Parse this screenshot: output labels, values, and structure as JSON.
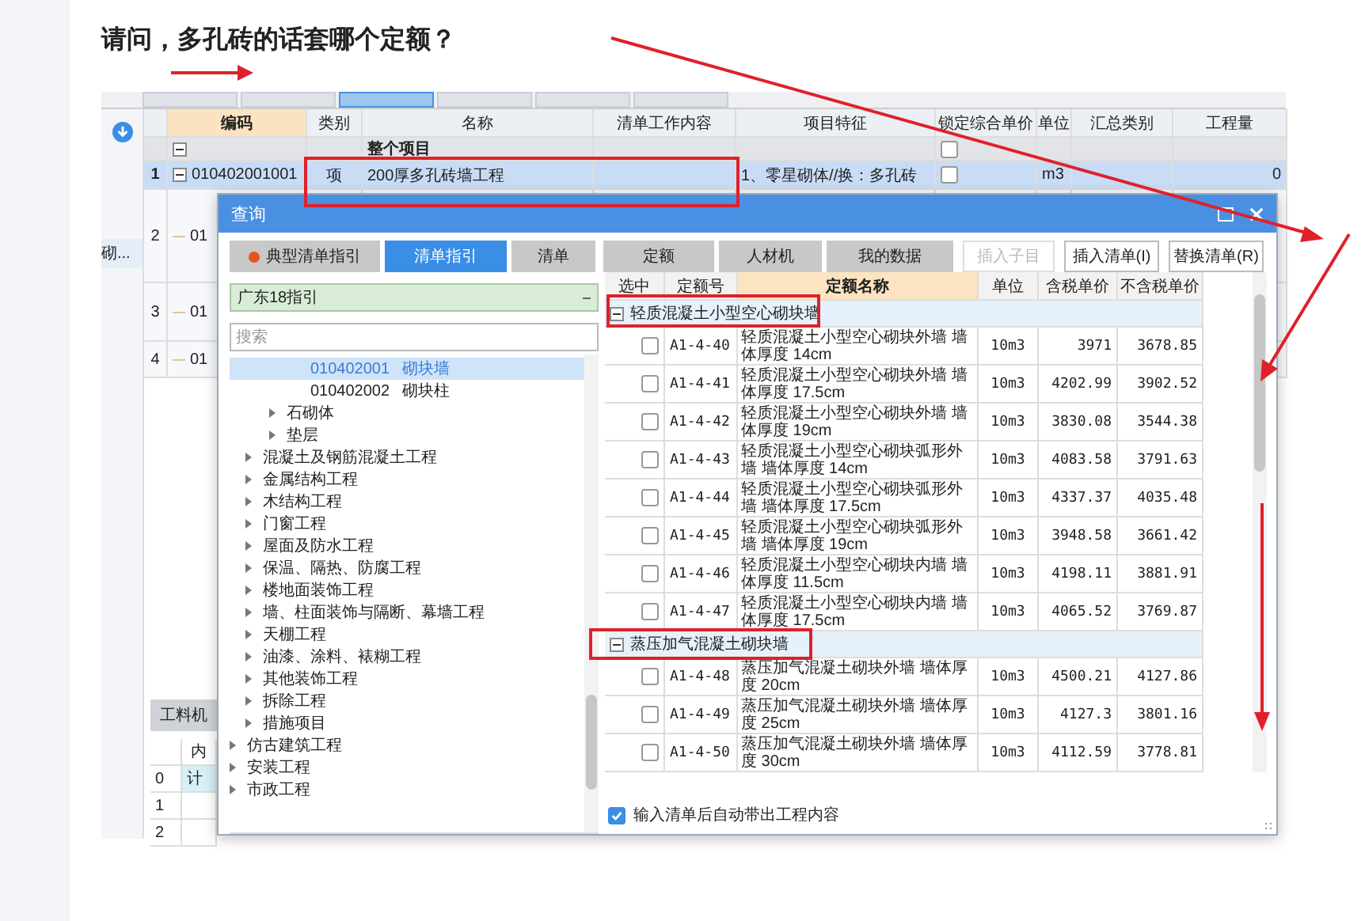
{
  "question": "请问，多孔砖的话套哪个定额？",
  "app": {
    "tabs": [
      {
        "selected": false
      },
      {
        "selected": false
      },
      {
        "selected": true
      },
      {
        "selected": false
      },
      {
        "selected": false
      },
      {
        "selected": false
      }
    ],
    "columns": [
      "编码",
      "类别",
      "名称",
      "清单工作内容",
      "项目特征",
      "锁定综合单价",
      "单位",
      "汇总类别",
      "工程量"
    ],
    "rows": [
      {
        "kind": "group",
        "name": "整个项目",
        "expanded": true,
        "locked": false,
        "selected": false
      },
      {
        "kind": "item",
        "number": "1",
        "code": "010402001001",
        "type": "项",
        "name": "200厚多孔砖墙工程",
        "feature": "1、零星砌体//换：多孔砖",
        "locked": false,
        "unit": "m3",
        "quantity": "0",
        "expanded": true,
        "selected": true
      },
      {
        "kind": "stub",
        "number": "2",
        "code": "01",
        "selected": false
      },
      {
        "kind": "stub",
        "number": "3",
        "code": "01",
        "selected": false
      },
      {
        "kind": "stub",
        "number": "4",
        "code": "01",
        "selected": false
      }
    ],
    "side_item": "砌...",
    "bottom": {
      "tab": "工料机",
      "column": "内",
      "rows": [
        {
          "number": "0",
          "content": "计"
        },
        {
          "number": "1"
        },
        {
          "number": "2"
        }
      ]
    }
  },
  "dialog": {
    "title": "查询",
    "tabs": [
      {
        "label": "典型清单指引",
        "selected": false,
        "marked": true
      },
      {
        "label": "清单指引",
        "selected": true,
        "marked": false
      },
      {
        "label": "清单",
        "selected": false,
        "marked": false
      },
      {
        "label": "定额",
        "selected": false,
        "marked": false
      },
      {
        "label": "人材机",
        "selected": false,
        "marked": false
      },
      {
        "label": "我的数据",
        "selected": false,
        "marked": false
      }
    ],
    "buttons": [
      {
        "label": "插入子目",
        "disabled": true
      },
      {
        "label": "插入清单(I)",
        "disabled": false
      },
      {
        "label": "替换清单(R)",
        "disabled": false
      }
    ],
    "guide": {
      "value": "广东18指引"
    },
    "search": {
      "placeholder": "搜索"
    },
    "tree": [
      {
        "children": [
          {
            "children": [
              {
                "children": [
                  {
                    "code": "010402001",
                    "label": "砌块墙",
                    "selected": true
                  },
                  {
                    "code": "010402002",
                    "label": "砌块柱",
                    "selected": false
                  }
                ]
              },
              {
                "label": "石砌体",
                "expanded": false,
                "selected": false
              },
              {
                "label": "垫层",
                "expanded": false,
                "selected": false
              }
            ]
          },
          {
            "label": "混凝土及钢筋混凝土工程",
            "expanded": false,
            "selected": false
          },
          {
            "label": "金属结构工程",
            "expanded": false,
            "selected": false
          },
          {
            "label": "木结构工程",
            "expanded": false,
            "selected": false
          },
          {
            "label": "门窗工程",
            "expanded": false,
            "selected": false
          },
          {
            "label": "屋面及防水工程",
            "expanded": false,
            "selected": false
          },
          {
            "label": "保温、隔热、防腐工程",
            "expanded": false,
            "selected": false
          },
          {
            "label": "楼地面装饰工程",
            "expanded": false,
            "selected": false
          },
          {
            "label": "墙、柱面装饰与隔断、幕墙工程",
            "expanded": false,
            "selected": false
          },
          {
            "label": "天棚工程",
            "expanded": false,
            "selected": false
          },
          {
            "label": "油漆、涂料、裱糊工程",
            "expanded": false,
            "selected": false
          },
          {
            "label": "其他装饰工程",
            "expanded": false,
            "selected": false
          },
          {
            "label": "拆除工程",
            "expanded": false,
            "selected": false
          },
          {
            "label": "措施项目",
            "expanded": false,
            "selected": false
          }
        ]
      },
      {
        "label": "仿古建筑工程",
        "expanded": false,
        "selected": false
      },
      {
        "label": "安装工程",
        "expanded": false,
        "selected": false
      },
      {
        "label": "市政工程",
        "expanded": false,
        "selected": false
      }
    ],
    "table": {
      "columns": [
        "选中",
        "定额号",
        "定额名称",
        "单位",
        "含税单价",
        "不含税单价"
      ],
      "groups": [
        {
          "name": "轻质混凝土小型空心砌块墙",
          "expanded": true,
          "rows": [
            {
              "code": "A1-4-40",
              "name": "轻质混凝土小型空心砌块外墙 墙体厚度 14cm",
              "unit": "10m3",
              "price": "3971",
              "price_ex": "3678.85",
              "checked": false
            },
            {
              "code": "A1-4-41",
              "name": "轻质混凝土小型空心砌块外墙 墙体厚度 17.5cm",
              "unit": "10m3",
              "price": "4202.99",
              "price_ex": "3902.52",
              "checked": false
            },
            {
              "code": "A1-4-42",
              "name": "轻质混凝土小型空心砌块外墙 墙体厚度 19cm",
              "unit": "10m3",
              "price": "3830.08",
              "price_ex": "3544.38",
              "checked": false
            },
            {
              "code": "A1-4-43",
              "name": "轻质混凝土小型空心砌块弧形外墙 墙体厚度 14cm",
              "unit": "10m3",
              "price": "4083.58",
              "price_ex": "3791.63",
              "checked": false
            },
            {
              "code": "A1-4-44",
              "name": "轻质混凝土小型空心砌块弧形外墙 墙体厚度 17.5cm",
              "unit": "10m3",
              "price": "4337.37",
              "price_ex": "4035.48",
              "checked": false
            },
            {
              "code": "A1-4-45",
              "name": "轻质混凝土小型空心砌块弧形外墙 墙体厚度 19cm",
              "unit": "10m3",
              "price": "3948.58",
              "price_ex": "3661.42",
              "checked": false
            },
            {
              "code": "A1-4-46",
              "name": "轻质混凝土小型空心砌块内墙 墙体厚度 11.5cm",
              "unit": "10m3",
              "price": "4198.11",
              "price_ex": "3881.91",
              "checked": false
            },
            {
              "code": "A1-4-47",
              "name": "轻质混凝土小型空心砌块内墙 墙体厚度 17.5cm",
              "unit": "10m3",
              "price": "4065.52",
              "price_ex": "3769.87",
              "checked": false
            }
          ]
        },
        {
          "name": "蒸压加气混凝土砌块墙",
          "expanded": true,
          "rows": [
            {
              "code": "A1-4-48",
              "name": "蒸压加气混凝土砌块外墙 墙体厚度 20cm",
              "unit": "10m3",
              "price": "4500.21",
              "price_ex": "4127.86",
              "checked": false
            },
            {
              "code": "A1-4-49",
              "name": "蒸压加气混凝土砌块外墙 墙体厚度 25cm",
              "unit": "10m3",
              "price": "4127.3",
              "price_ex": "3801.16",
              "checked": false
            },
            {
              "code": "A1-4-50",
              "name": "蒸压加气混凝土砌块外墙 墙体厚度 30cm",
              "unit": "10m3",
              "price": "4112.59",
              "price_ex": "3778.81",
              "checked": false
            }
          ]
        }
      ]
    },
    "auto_fill": {
      "label": "输入清单后自动带出工程内容",
      "checked": true
    }
  }
}
